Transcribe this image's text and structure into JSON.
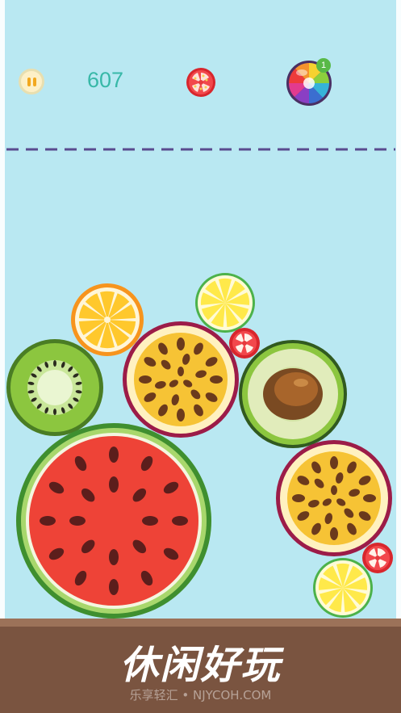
{
  "hud": {
    "score": "607",
    "next_fruit": "tomato",
    "rainbow_badge": "1",
    "pause_icon": "pause-icon",
    "rainbow_icon": "rainbow-ball-icon"
  },
  "fruits": [
    "orange-slice",
    "lemon-slice",
    "kiwi-slice",
    "passion-fruit",
    "tomato",
    "avocado",
    "watermelon-slice",
    "passion-fruit",
    "tomato",
    "lemon-slice"
  ],
  "banner": {
    "title": "休闲好玩",
    "watermark": "乐享轻汇 • NJYCOH.COM"
  },
  "colors": {
    "background": "#b9e8f2",
    "ground": "#7a5440",
    "dash": "#5a4b8f",
    "score": "#38b8a8"
  }
}
